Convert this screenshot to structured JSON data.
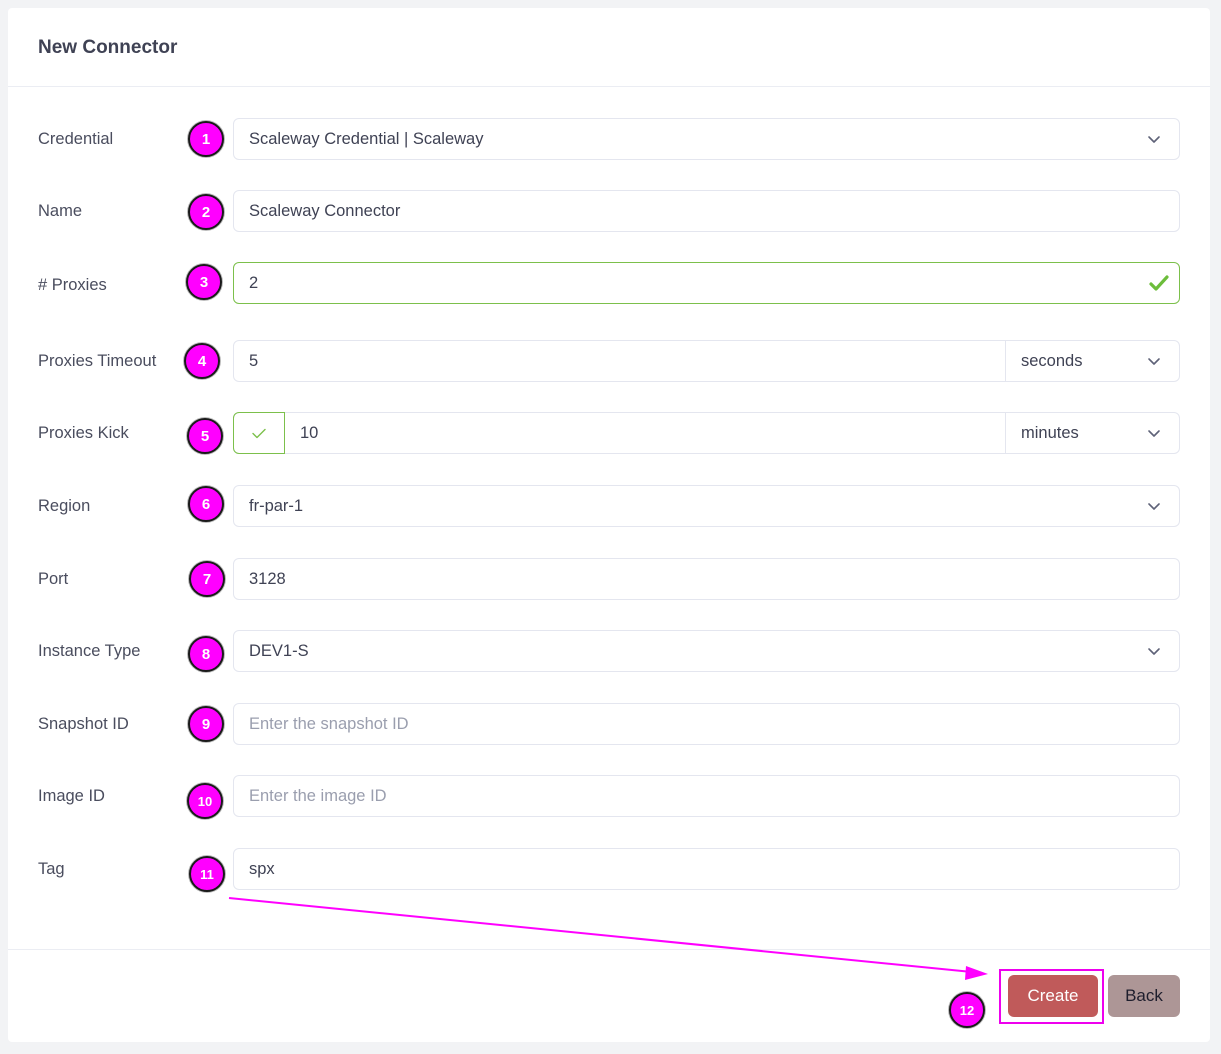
{
  "header": {
    "title": "New Connector"
  },
  "form": {
    "credential": {
      "label": "Credential",
      "value": "Scaleway Credential | Scaleway"
    },
    "name": {
      "label": "Name",
      "value": "Scaleway Connector"
    },
    "proxies": {
      "label": "# Proxies",
      "value": "2"
    },
    "proxies_timeout": {
      "label": "Proxies Timeout",
      "value": "5",
      "unit": "seconds"
    },
    "proxies_kick": {
      "label": "Proxies Kick",
      "enabled": true,
      "value": "10",
      "unit": "minutes"
    },
    "region": {
      "label": "Region",
      "value": "fr-par-1"
    },
    "port": {
      "label": "Port",
      "value": "3128"
    },
    "instance_type": {
      "label": "Instance Type",
      "value": "DEV1-S"
    },
    "snapshot_id": {
      "label": "Snapshot ID",
      "value": "",
      "placeholder": "Enter the snapshot ID"
    },
    "image_id": {
      "label": "Image ID",
      "value": "",
      "placeholder": "Enter the image ID"
    },
    "tag": {
      "label": "Tag",
      "value": "spx"
    }
  },
  "footer": {
    "create_label": "Create",
    "back_label": "Back"
  },
  "annotations": {
    "badges": [
      "1",
      "2",
      "3",
      "4",
      "5",
      "6",
      "7",
      "8",
      "9",
      "10",
      "11",
      "12"
    ],
    "color": "#ff00ff"
  },
  "colors": {
    "valid": "#7cc04b",
    "create_button": "#c05a5a",
    "back_button": "#ad9696"
  }
}
